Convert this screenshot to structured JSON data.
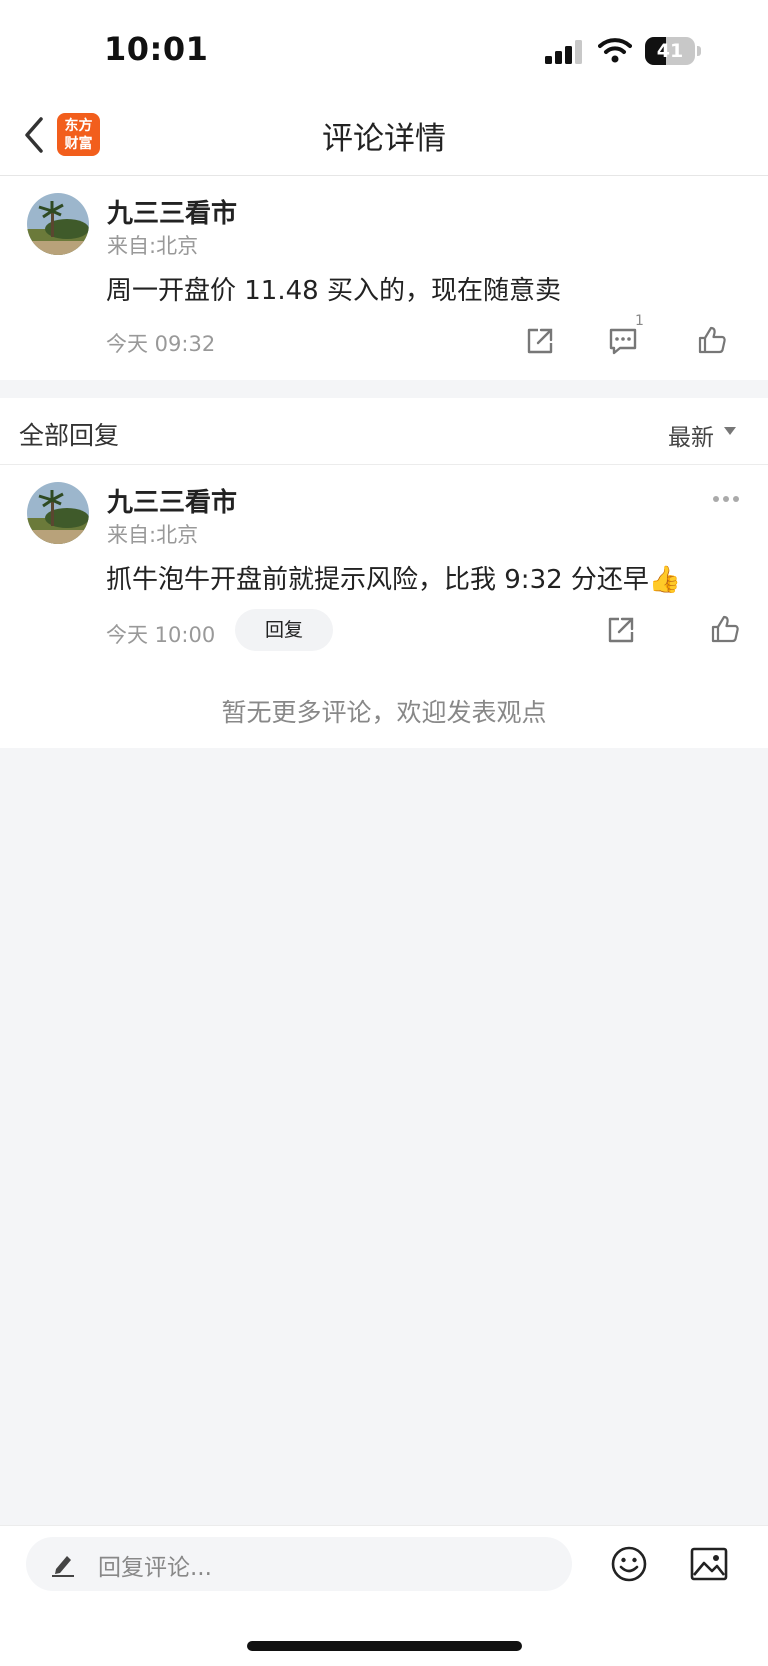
{
  "status_bar": {
    "time": "10:01",
    "battery": "41",
    "battery_level": 0.41
  },
  "header": {
    "logo_line1": "东方",
    "logo_line2": "财富",
    "title": "评论详情"
  },
  "main_comment": {
    "username": "九三三看市",
    "location": "来自:北京",
    "content": "周一开盘价 11.48 买入的，现在随意卖",
    "time": "今天 09:32",
    "reply_count": "1"
  },
  "replies_section": {
    "title": "全部回复",
    "sort_label": "最新"
  },
  "reply": {
    "username": "九三三看市",
    "location": "来自:北京",
    "content": "抓牛泡牛开盘前就提示风险，比我 9:32 分还早👍",
    "time": "今天 10:00",
    "reply_button": "回复"
  },
  "empty_note": "暂无更多评论，欢迎发表观点",
  "bottom_bar": {
    "placeholder": "回复评论..."
  },
  "colors": {
    "brand": "#f25e1c",
    "background": "#f4f5f7"
  }
}
